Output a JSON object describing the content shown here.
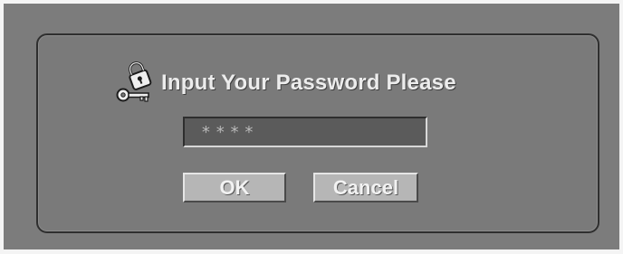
{
  "dialog": {
    "title": "Input Your Password Please",
    "password_value": "****",
    "ok_label": "OK",
    "cancel_label": "Cancel",
    "icon": "key-lock-icon"
  },
  "colors": {
    "panel": "#7a7a7a",
    "button": "#b6b6b6",
    "field": "#5b5b5b",
    "text": "#ececec"
  }
}
